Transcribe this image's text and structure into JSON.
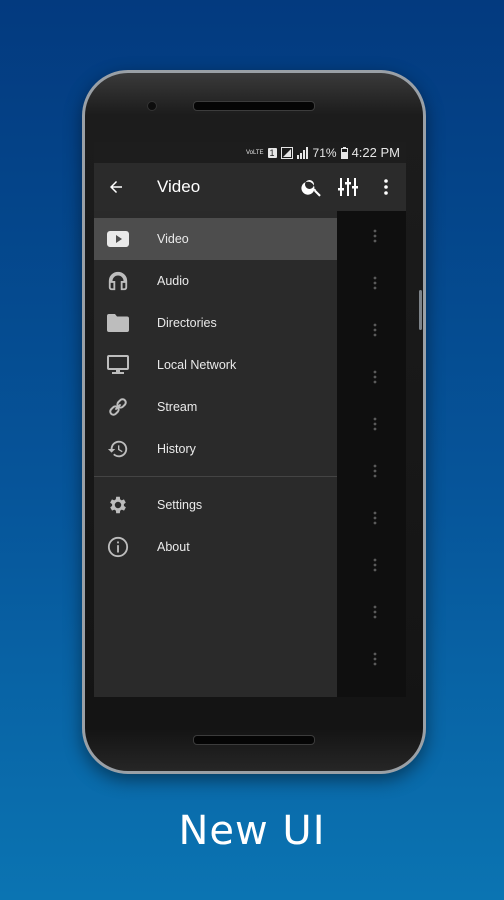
{
  "status_bar": {
    "volte": "VoLTE",
    "sim": "1",
    "battery": "71%",
    "time": "4:22 PM"
  },
  "toolbar": {
    "title": "Video",
    "icons": [
      "arrow-back-icon",
      "search-icon",
      "equalizer-icon",
      "more-vert-icon"
    ]
  },
  "drawer": {
    "items": [
      {
        "label": "Video",
        "icon": "video-play-icon",
        "active": true
      },
      {
        "label": "Audio",
        "icon": "headphones-icon"
      },
      {
        "label": "Directories",
        "icon": "folder-icon"
      },
      {
        "label": "Local Network",
        "icon": "monitor-icon"
      },
      {
        "label": "Stream",
        "icon": "link-icon"
      },
      {
        "label": "History",
        "icon": "history-icon"
      }
    ],
    "secondary_items": [
      {
        "label": "Settings",
        "icon": "gear-icon"
      },
      {
        "label": "About",
        "icon": "info-icon"
      }
    ]
  },
  "tagline": "New UI",
  "colors": {
    "background_top": "#033a7f",
    "background_bottom": "#0b74b2",
    "drawer_bg": "#2a2a2a",
    "toolbar_bg": "#2b2b2b",
    "active_item_bg": "#4d4d4d"
  }
}
